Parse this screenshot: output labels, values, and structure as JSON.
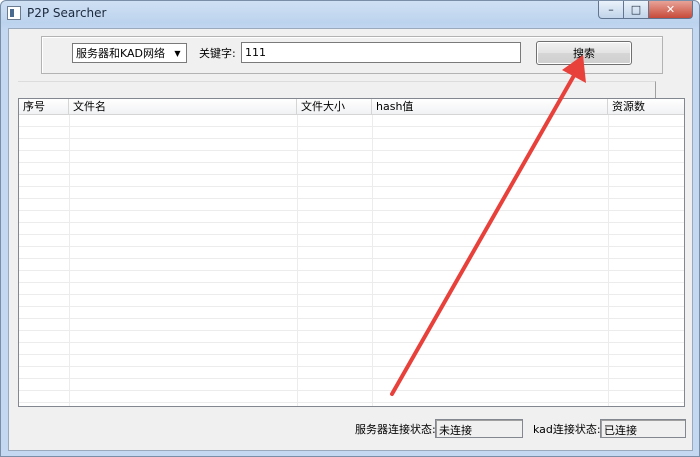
{
  "window": {
    "title": "P2P Searcher"
  },
  "titlebar": {
    "minimize": "–",
    "maximize": "□",
    "close": "✕"
  },
  "search": {
    "network_select": "服务器和KAD网络",
    "keyword_label": "关键字:",
    "keyword_value": "111",
    "button_label": "搜索"
  },
  "table": {
    "columns": [
      "序号",
      "文件名",
      "文件大小",
      "hash值",
      "资源数"
    ]
  },
  "status": {
    "server_label": "服务器连接状态:",
    "server_value": "未连接",
    "kad_label": "kad连接状态:",
    "kad_value": "已连接"
  },
  "annotation": {
    "arrow_color": "#e8403a"
  }
}
